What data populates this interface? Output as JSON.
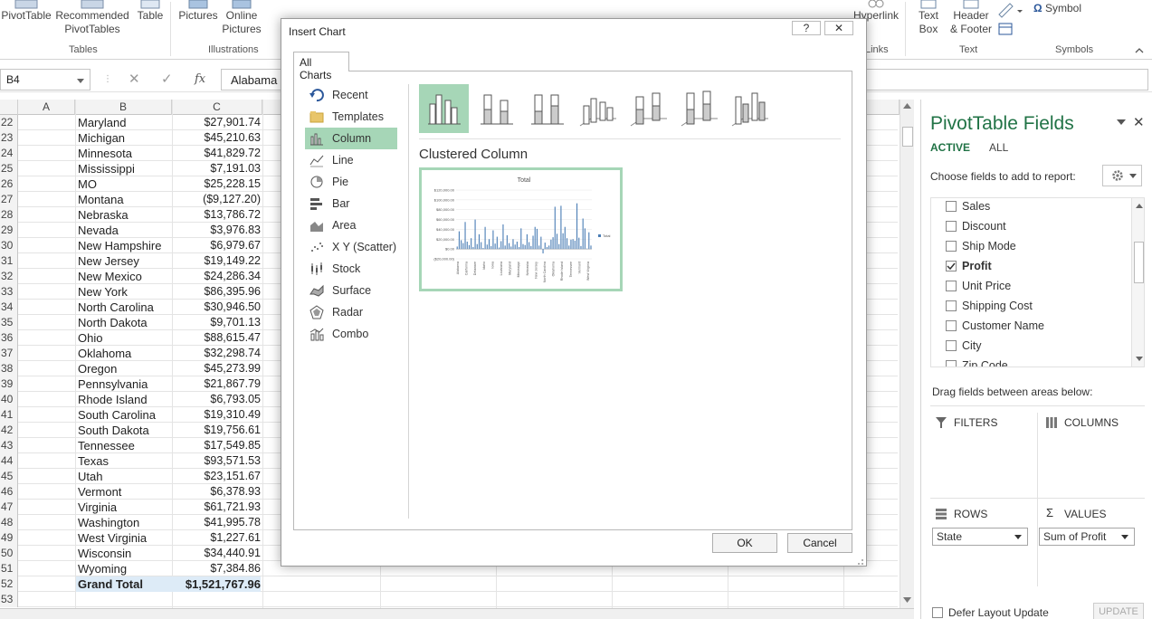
{
  "ribbon": {
    "pivottable": "PivotTable",
    "recommended_line1": "Recommended",
    "recommended_line2": "PivotTables",
    "table": "Table",
    "pictures": "Pictures",
    "online_line1": "Online",
    "online_line2": "Pictures",
    "hyperlink": "Hyperlink",
    "textbox_line1": "Text",
    "textbox_line2": "Box",
    "header_line1": "Header",
    "header_line2": "& Footer",
    "symbol": "Symbol",
    "omega": "Ω",
    "group_tables": "Tables",
    "group_illustrations": "Illustrations",
    "group_links": "Links",
    "group_text": "Text",
    "group_symbols": "Symbols"
  },
  "formula_bar": {
    "name_box": "B4",
    "cancel": "✕",
    "enter": "✓",
    "fx": "fx",
    "value": "Alabama"
  },
  "sheet": {
    "col_headers": [
      "A",
      "B",
      "C"
    ],
    "rows": [
      {
        "n": "22",
        "state": "Maryland",
        "profit": "$27,901.74"
      },
      {
        "n": "23",
        "state": "Michigan",
        "profit": "$45,210.63"
      },
      {
        "n": "24",
        "state": "Minnesota",
        "profit": "$41,829.72"
      },
      {
        "n": "25",
        "state": "Mississippi",
        "profit": "$7,191.03"
      },
      {
        "n": "26",
        "state": "MO",
        "profit": "$25,228.15"
      },
      {
        "n": "27",
        "state": "Montana",
        "profit": "($9,127.20)"
      },
      {
        "n": "28",
        "state": "Nebraska",
        "profit": "$13,786.72"
      },
      {
        "n": "29",
        "state": "Nevada",
        "profit": "$3,976.83"
      },
      {
        "n": "30",
        "state": "New Hampshire",
        "profit": "$6,979.67"
      },
      {
        "n": "31",
        "state": "New Jersey",
        "profit": "$19,149.22"
      },
      {
        "n": "32",
        "state": "New Mexico",
        "profit": "$24,286.34"
      },
      {
        "n": "33",
        "state": "New York",
        "profit": "$86,395.96"
      },
      {
        "n": "34",
        "state": "North Carolina",
        "profit": "$30,946.50"
      },
      {
        "n": "35",
        "state": "North Dakota",
        "profit": "$9,701.13"
      },
      {
        "n": "36",
        "state": "Ohio",
        "profit": "$88,615.47"
      },
      {
        "n": "37",
        "state": "Oklahoma",
        "profit": "$32,298.74"
      },
      {
        "n": "38",
        "state": "Oregon",
        "profit": "$45,273.99"
      },
      {
        "n": "39",
        "state": "Pennsylvania",
        "profit": "$21,867.79"
      },
      {
        "n": "40",
        "state": "Rhode Island",
        "profit": "$6,793.05"
      },
      {
        "n": "41",
        "state": "South Carolina",
        "profit": "$19,310.49"
      },
      {
        "n": "42",
        "state": "South Dakota",
        "profit": "$19,756.61"
      },
      {
        "n": "43",
        "state": "Tennessee",
        "profit": "$17,549.85"
      },
      {
        "n": "44",
        "state": "Texas",
        "profit": "$93,571.53"
      },
      {
        "n": "45",
        "state": "Utah",
        "profit": "$23,151.67"
      },
      {
        "n": "46",
        "state": "Vermont",
        "profit": "$6,378.93"
      },
      {
        "n": "47",
        "state": "Virginia",
        "profit": "$61,721.93"
      },
      {
        "n": "48",
        "state": "Washington",
        "profit": "$41,995.78"
      },
      {
        "n": "49",
        "state": "West Virginia",
        "profit": "$1,227.61"
      },
      {
        "n": "50",
        "state": "Wisconsin",
        "profit": "$34,440.91"
      },
      {
        "n": "51",
        "state": "Wyoming",
        "profit": "$7,384.86"
      },
      {
        "n": "52",
        "state": "Grand Total",
        "profit": "$1,521,767.96"
      },
      {
        "n": "53",
        "state": "",
        "profit": ""
      }
    ]
  },
  "dialog": {
    "title": "Insert Chart",
    "help": "?",
    "close": "✕",
    "tab": "All Charts",
    "chart_types": [
      "Recent",
      "Templates",
      "Column",
      "Line",
      "Pie",
      "Bar",
      "Area",
      "X Y (Scatter)",
      "Stock",
      "Surface",
      "Radar",
      "Combo"
    ],
    "selected_type": "Column",
    "subtype_name": "Clustered Column",
    "ok": "OK",
    "cancel": "Cancel",
    "preview": {
      "title": "Total",
      "legend": "Total",
      "y_ticks": [
        "$120,000.00",
        "$100,000.00",
        "$80,000.00",
        "$60,000.00",
        "$40,000.00",
        "$20,000.00",
        "$0.00",
        "($20,000.00)"
      ],
      "x_labels": [
        "Alabama",
        "California",
        "Delaware",
        "Idaho",
        "Iowa",
        "Louisiana",
        "Maryland",
        "Mississippi",
        "Nebraska",
        "New Jersey",
        "North Carolina",
        "Oklahoma",
        "Rhode Island",
        "Tennessee",
        "Vermont",
        "West Virginia"
      ]
    }
  },
  "chart_data": {
    "type": "bar",
    "title": "Total",
    "legend": [
      "Total"
    ],
    "ylim": [
      -20000,
      120000
    ],
    "values": [
      5000,
      36000,
      18000,
      12000,
      55000,
      15000,
      8000,
      22000,
      4000,
      60000,
      10000,
      30000,
      14000,
      2000,
      45000,
      9000,
      20000,
      6000,
      38000,
      11000,
      25000,
      3000,
      16000,
      50000,
      7000,
      28000,
      12000,
      5000,
      20000,
      9000,
      15000,
      4000,
      42000,
      10000,
      8000,
      30000,
      14000,
      6000,
      27000,
      45000,
      41000,
      7000,
      25000,
      -9000,
      13000,
      4000,
      7000,
      19000,
      24000,
      86000,
      31000,
      10000,
      88000,
      32000,
      45000,
      22000,
      7000,
      19000,
      20000,
      17000,
      93000,
      23000,
      6000,
      62000,
      42000,
      1000,
      34000,
      7000
    ]
  },
  "pivot": {
    "title": "PivotTable Fields",
    "tab_active": "ACTIVE",
    "tab_all": "ALL",
    "choose": "Choose fields to add to report:",
    "fields": [
      {
        "name": "Sales",
        "checked": false
      },
      {
        "name": "Discount",
        "checked": false
      },
      {
        "name": "Ship Mode",
        "checked": false
      },
      {
        "name": "Profit",
        "checked": true
      },
      {
        "name": "Unit Price",
        "checked": false
      },
      {
        "name": "Shipping Cost",
        "checked": false
      },
      {
        "name": "Customer Name",
        "checked": false
      },
      {
        "name": "City",
        "checked": false
      },
      {
        "name": "Zip Code",
        "checked": false
      }
    ],
    "drag_label": "Drag fields between areas below:",
    "filters": "FILTERS",
    "columns": "COLUMNS",
    "rows": "ROWS",
    "values": "VALUES",
    "rows_value": "State",
    "values_value": "Sum of Profit",
    "defer": "Defer Layout Update",
    "update": "UPDATE"
  },
  "colors": {
    "accent": "#217346",
    "selection": "#a6d6b7",
    "bar": "#4a7db5",
    "total_row": "#ddebf7"
  }
}
